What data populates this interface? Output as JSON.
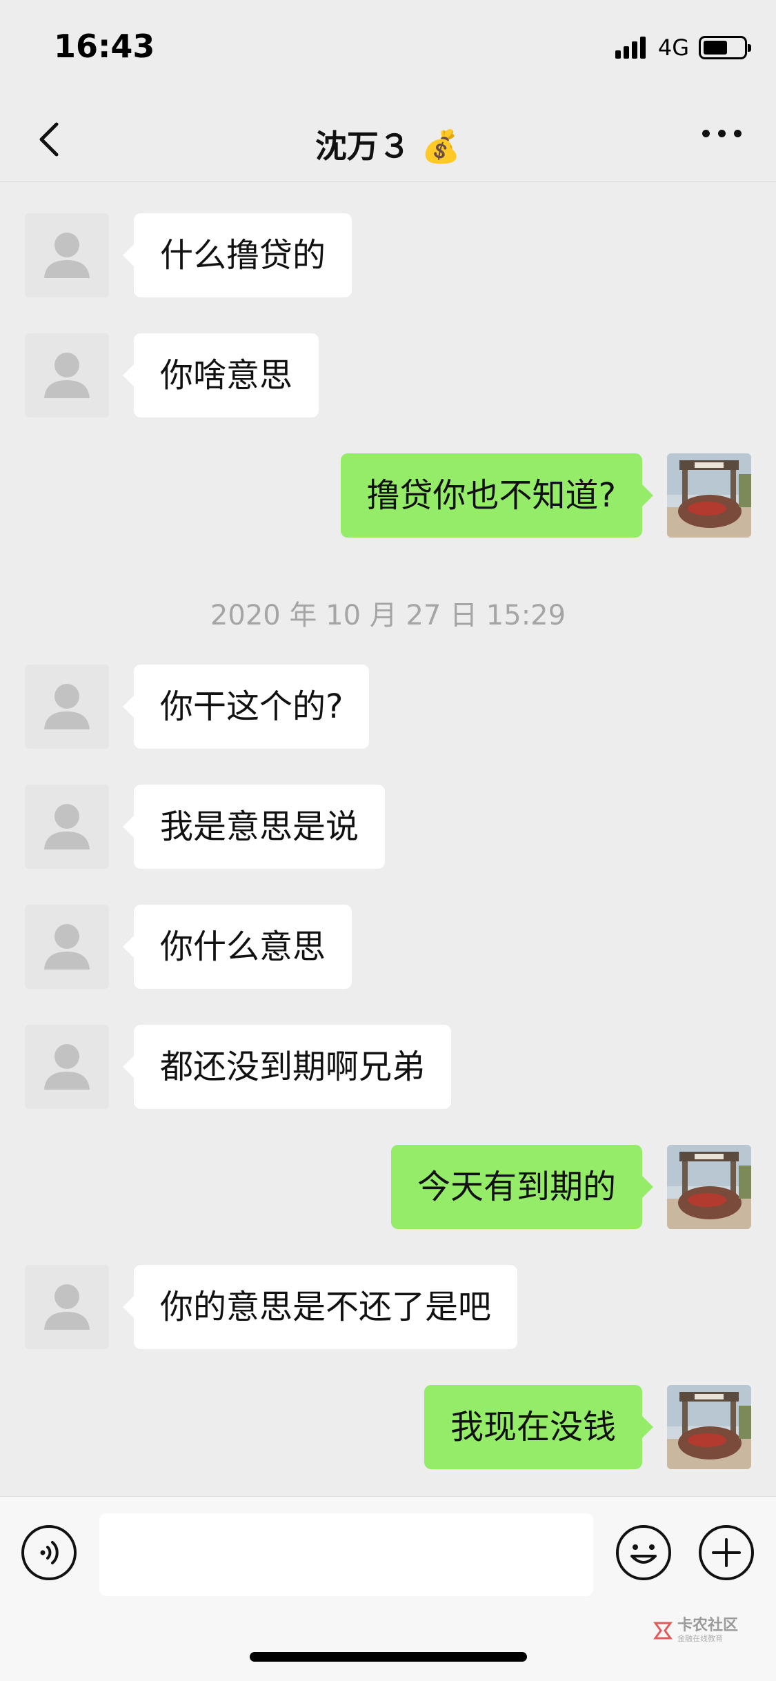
{
  "status_bar": {
    "time": "16:43",
    "network": "4G",
    "battery_level": 0.6
  },
  "nav": {
    "title": "沈万３",
    "title_emoji": "💰",
    "back_icon": "chevron-left-icon",
    "more_icon": "ellipsis-icon"
  },
  "messages": [
    {
      "side": "left",
      "text": "什么撸贷的"
    },
    {
      "side": "left",
      "text": "你啥意思"
    },
    {
      "side": "right",
      "text": "撸贷你也不知道?"
    },
    {
      "side": "timestamp",
      "text": "2020 年 10 月 27 日 15:29"
    },
    {
      "side": "left",
      "text": "你干这个的?"
    },
    {
      "side": "left",
      "text": "我是意思是说"
    },
    {
      "side": "left",
      "text": "你什么意思"
    },
    {
      "side": "left",
      "text": "都还没到期啊兄弟"
    },
    {
      "side": "right",
      "text": "今天有到期的"
    },
    {
      "side": "left",
      "text": "你的意思是不还了是吧"
    },
    {
      "side": "right",
      "text": "我现在没钱"
    }
  ],
  "input_bar": {
    "input_value": "",
    "voice_icon": "voice-icon",
    "emoji_icon": "emoji-icon",
    "plus_icon": "plus-icon"
  },
  "watermark": {
    "main": "卡农社区",
    "sub": "金融在线教育"
  },
  "colors": {
    "background": "#ededed",
    "bubble_self": "#95ec69",
    "bubble_other": "#ffffff",
    "timestamp": "#a5a5a5"
  }
}
